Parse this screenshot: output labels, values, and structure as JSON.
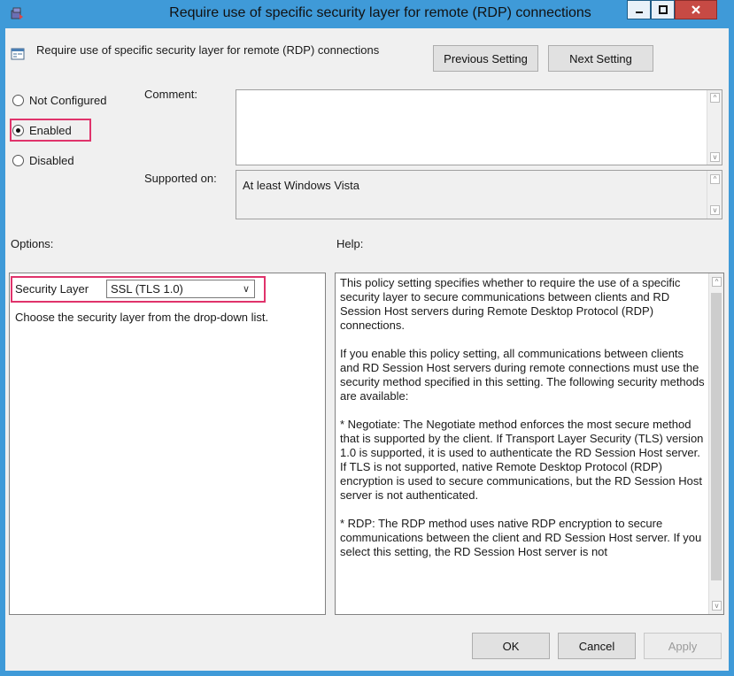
{
  "window": {
    "title": "Require use of specific security layer for remote (RDP) connections"
  },
  "header": {
    "setting_name": "Require use of specific security layer for remote (RDP) connections",
    "previous_label": "Previous Setting",
    "next_label": "Next Setting"
  },
  "state": {
    "options": [
      {
        "label": "Not Configured",
        "checked": false
      },
      {
        "label": "Enabled",
        "checked": true
      },
      {
        "label": "Disabled",
        "checked": false
      }
    ]
  },
  "comment": {
    "label": "Comment:",
    "value": ""
  },
  "supported": {
    "label": "Supported on:",
    "value": "At least Windows Vista"
  },
  "options_section": {
    "label": "Options:",
    "security_layer_label": "Security Layer",
    "security_layer_value": "SSL (TLS 1.0)",
    "instruction": "Choose the security layer from the drop-down list."
  },
  "help_section": {
    "label": "Help:",
    "paragraphs": [
      "This policy setting specifies whether to require the use of a specific security layer to secure communications between clients and RD Session Host servers during Remote Desktop Protocol (RDP) connections.",
      "If you enable this policy setting, all communications between clients and RD Session Host servers during remote connections must use the security method specified in this setting. The following security methods are available:",
      "* Negotiate: The Negotiate method enforces the most secure method that is supported by the client. If Transport Layer Security (TLS) version 1.0 is supported, it is used to authenticate the RD Session Host server. If TLS is not supported, native Remote Desktop Protocol (RDP) encryption is used to secure communications, but the RD Session Host server is not authenticated.",
      "* RDP: The RDP method uses native RDP encryption to secure communications between the client and RD Session Host server. If you select this setting, the RD Session Host server is not"
    ]
  },
  "footer": {
    "ok_label": "OK",
    "cancel_label": "Cancel",
    "apply_label": "Apply"
  },
  "colors": {
    "titlebar": "#3f9ad8",
    "close_button": "#c74a44",
    "highlight": "#e0336b"
  }
}
